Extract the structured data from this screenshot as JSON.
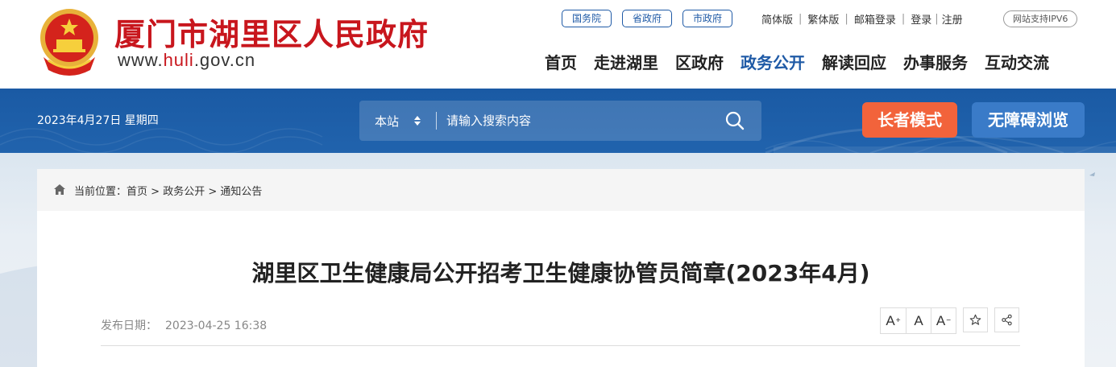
{
  "header": {
    "site_title": "厦门市湖里区人民政府",
    "site_url_prefix": "www.",
    "site_url_highlight": "huli",
    "site_url_suffix": ".gov.cn",
    "emblem_icon": "national-emblem-icon",
    "top_pills": [
      "国务院",
      "省政府",
      "市政府"
    ],
    "top_links": [
      "简体版",
      "繁体版",
      "邮箱登录",
      "登录",
      "注册"
    ],
    "ipv6_badge": "网站支持IPV6",
    "nav": [
      {
        "label": "首页",
        "active": false
      },
      {
        "label": "走进湖里",
        "active": false
      },
      {
        "label": "区政府",
        "active": false
      },
      {
        "label": "政务公开",
        "active": true
      },
      {
        "label": "解读回应",
        "active": false
      },
      {
        "label": "办事服务",
        "active": false
      },
      {
        "label": "互动交流",
        "active": false
      }
    ]
  },
  "band": {
    "date": "2023年4月27日 星期四",
    "search_scope": "本站",
    "search_placeholder": "请输入搜索内容",
    "elder_mode": "长者模式",
    "accessibility": "无障碍浏览"
  },
  "breadcrumb": {
    "prefix": "当前位置：",
    "items": [
      "首页",
      "政务公开",
      "通知公告"
    ],
    "separator": " > "
  },
  "article": {
    "title": "湖里区卫生健康局公开招考卫生健康协管员简章(2023年4月)",
    "date_label": "发布日期：",
    "date_value": "2023-04-25 16:38",
    "tools": {
      "font_larger": "A",
      "font_normal": "A",
      "font_smaller": "A"
    }
  },
  "colors": {
    "brand_red": "#c8161d",
    "brand_blue": "#1f5aa6",
    "elder_orange": "#f2633b",
    "access_blue": "#3a7bc8"
  }
}
